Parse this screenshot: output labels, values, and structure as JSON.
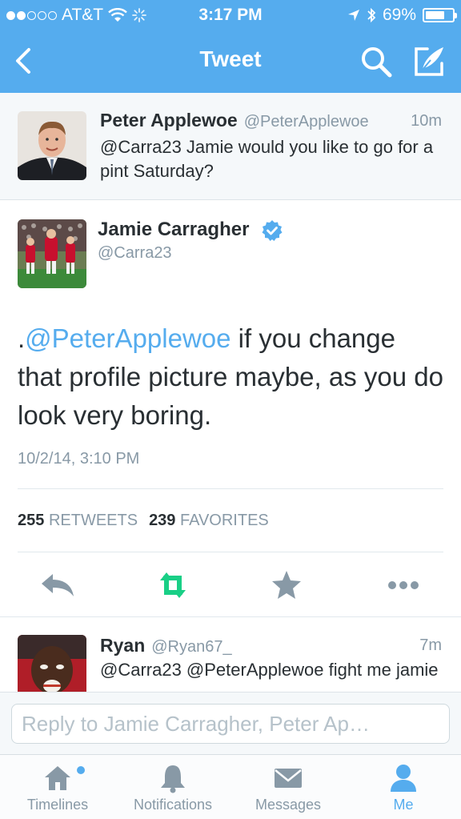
{
  "status_bar": {
    "carrier": "AT&T",
    "time": "3:17 PM",
    "battery": "69%",
    "battery_level": 0.69
  },
  "nav": {
    "title": "Tweet",
    "icons": [
      "back-chevron-icon",
      "search-icon",
      "compose-icon"
    ]
  },
  "context_tweet": {
    "name": "Peter Applewoe",
    "handle": "@PeterApplewoe",
    "time": "10m",
    "text": "@Carra23 Jamie would you like to go for a pint Saturday?"
  },
  "main_tweet": {
    "name": "Jamie Carragher",
    "handle": "@Carra23",
    "verified": true,
    "text_prefix": ".",
    "mention": "@PeterApplewoe",
    "text_rest": " if you change that profile picture maybe, as you do look very boring.",
    "timestamp": "10/2/14, 3:10 PM",
    "retweets_count": "255",
    "retweets_label": "RETWEETS",
    "favorites_count": "239",
    "favorites_label": "FAVORITES",
    "actions": [
      "reply-icon",
      "retweet-icon",
      "favorite-icon",
      "more-icon"
    ]
  },
  "reply_tweet": {
    "name": "Ryan",
    "handle": "@Ryan67_",
    "time": "7m",
    "text": "@Carra23 @PeterApplewoe fight me jamie"
  },
  "composer": {
    "placeholder": "Reply to Jamie Carragher, Peter Ap…"
  },
  "tabbar": {
    "tabs": [
      {
        "label": "Timelines",
        "icon": "home-icon",
        "active": false,
        "has_dot": true
      },
      {
        "label": "Notifications",
        "icon": "bell-icon",
        "active": false
      },
      {
        "label": "Messages",
        "icon": "envelope-icon",
        "active": false
      },
      {
        "label": "Me",
        "icon": "person-icon",
        "active": true
      }
    ]
  },
  "colors": {
    "brand_blue": "#55acee",
    "retweet_green": "#19cf86",
    "muted_gray": "#8899a6"
  }
}
